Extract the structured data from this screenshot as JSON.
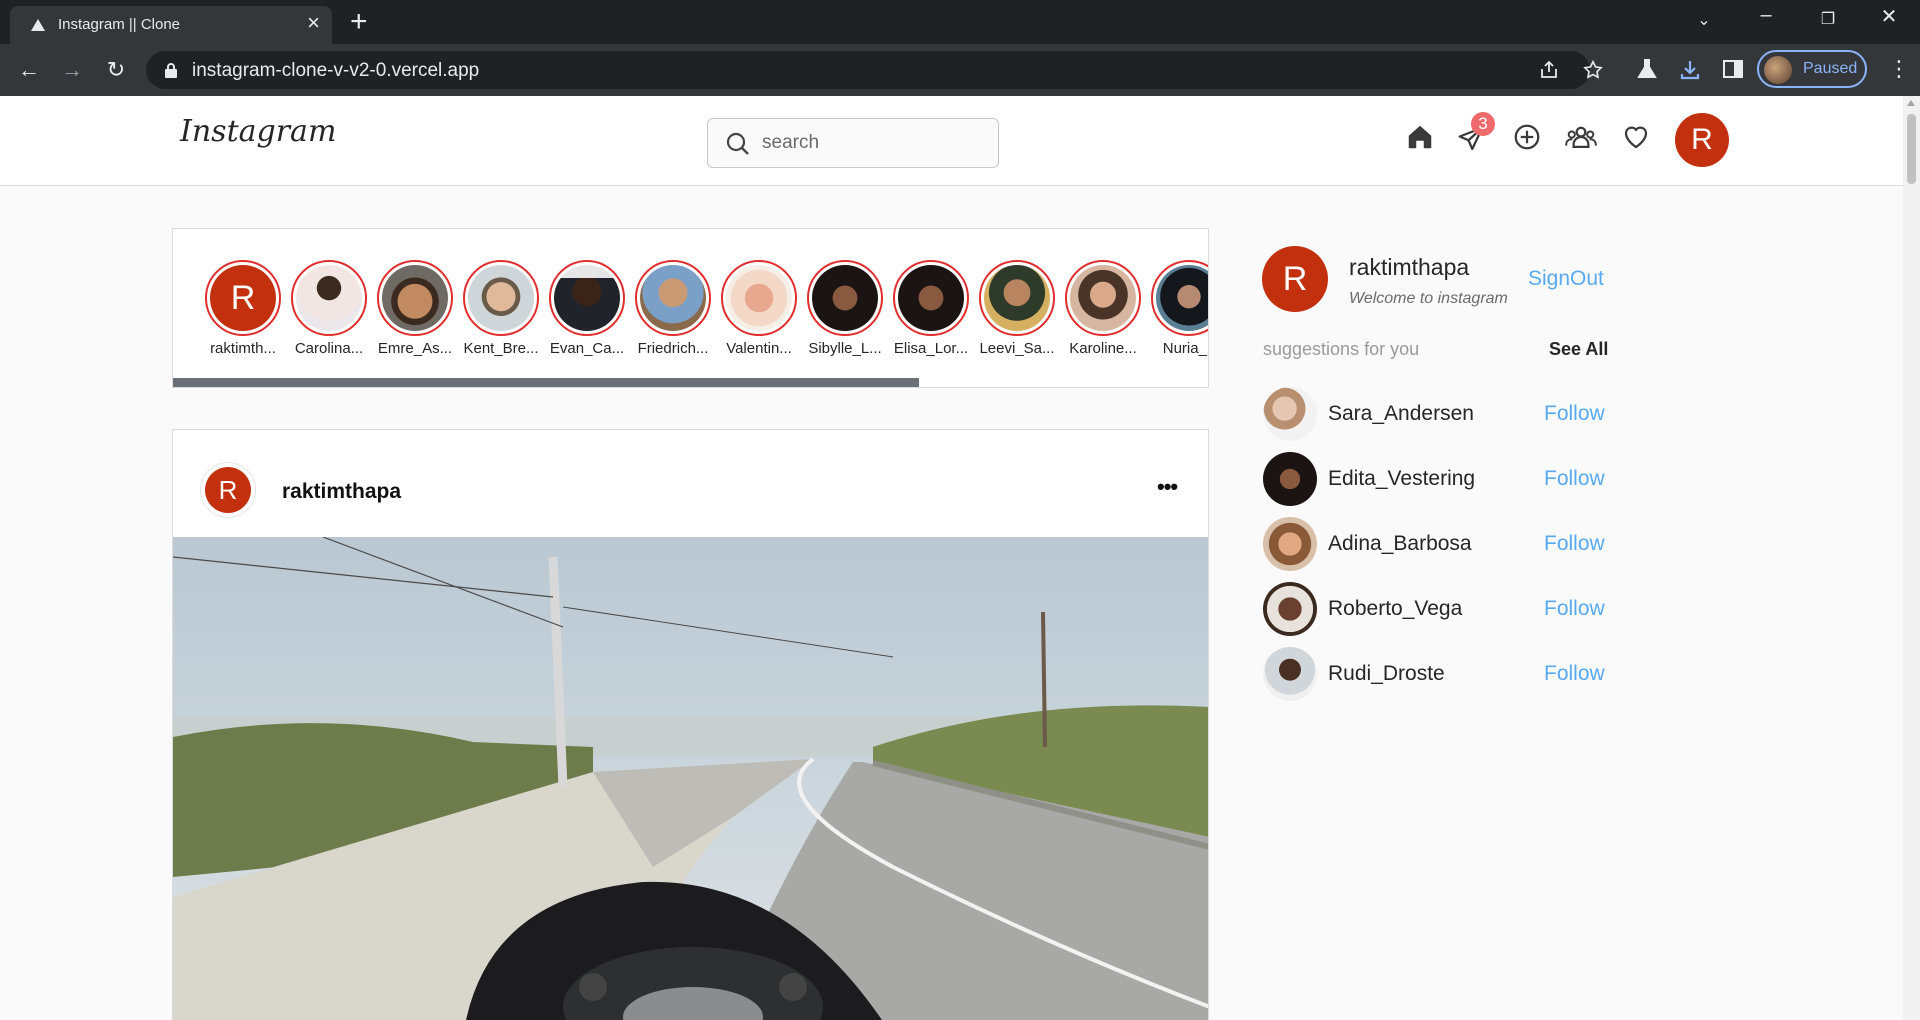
{
  "browser": {
    "tab_title": "Instagram || Clone",
    "url": "instagram-clone-v-v2-0.vercel.app",
    "profile_status": "Paused"
  },
  "header": {
    "logo": "Instagram",
    "search_placeholder": "search",
    "message_badge": "3",
    "avatar_letter": "R",
    "icons": [
      "home-icon",
      "send-icon",
      "add-circle-icon",
      "people-icon",
      "heart-icon"
    ]
  },
  "stories": [
    {
      "name": "raktimth...",
      "letter": "R"
    },
    {
      "name": "Carolina..."
    },
    {
      "name": "Emre_As..."
    },
    {
      "name": "Kent_Bre..."
    },
    {
      "name": "Evan_Ca..."
    },
    {
      "name": "Friedrich..."
    },
    {
      "name": "Valentin..."
    },
    {
      "name": "Sibylle_L..."
    },
    {
      "name": "Elisa_Lor..."
    },
    {
      "name": "Leevi_Sa..."
    },
    {
      "name": "Karoline..."
    },
    {
      "name": "Nuria_L"
    }
  ],
  "post": {
    "username": "raktimthapa",
    "avatar_letter": "R",
    "more": "•••"
  },
  "sidebar": {
    "avatar_letter": "R",
    "username": "raktimthapa",
    "subtitle": "Welcome to instagram",
    "signout": "SignOut",
    "suggestions_title": "suggestions for you",
    "see_all": "See All",
    "follow_label": "Follow",
    "suggestions": [
      {
        "name": "Sara_Andersen"
      },
      {
        "name": "Edita_Vestering"
      },
      {
        "name": "Adina_Barbosa"
      },
      {
        "name": "Roberto_Vega"
      },
      {
        "name": "Rudi_Droste"
      }
    ]
  },
  "colors": {
    "brand_red": "#c2300e",
    "story_ring": "#e02e2e",
    "link_blue": "#58a9f0"
  }
}
